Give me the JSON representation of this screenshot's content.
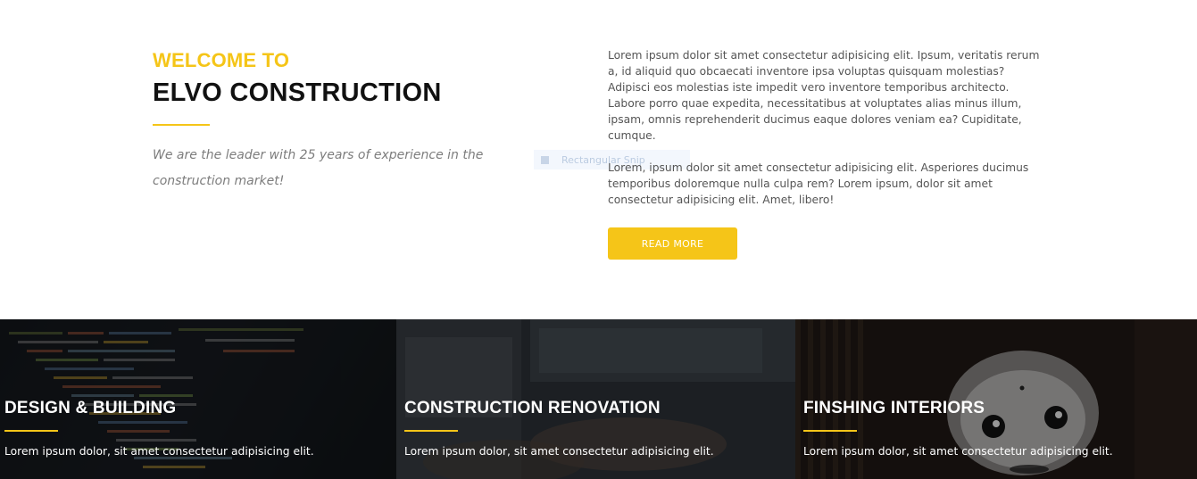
{
  "intro": {
    "welcome": "WELCOME TO",
    "title": "ELVO CONSTRUCTION",
    "tagline": "We are the leader with 25 years of experience in the construction market!",
    "paragraph_1": "Lorem ipsum dolor sit amet consectetur adipisicing elit. Ipsum, veritatis rerum a, id aliquid quo obcaecati inventore ipsa voluptas quisquam molestias? Adipisci eos molestias iste impedit vero inventore temporibus architecto. Labore porro quae expedita, necessitatibus at voluptates alias minus illum, ipsam, omnis reprehenderit ducimus eaque dolores veniam ea? Cupiditate, cumque.",
    "paragraph_2": "Lorem, ipsum dolor sit amet consectetur adipisicing elit. Asperiores ducimus temporibus doloremque nulla culpa rem? Lorem ipsum, dolor sit amet consectetur adipisicing elit. Amet, libero!",
    "read_more_label": "READ MORE",
    "ghost_label": "Rectangular Snip"
  },
  "services": [
    {
      "title": "DESIGN & BUILDING",
      "text": "Lorem ipsum dolor, sit amet consectetur adipisicing elit.",
      "image_icon": "code-screen-image"
    },
    {
      "title": "CONSTRUCTION RENOVATION",
      "text": "Lorem ipsum dolor, sit amet consectetur adipisicing elit.",
      "image_icon": "laptop-typing-image"
    },
    {
      "title": "FINSHING INTERIORS",
      "text": "Lorem ipsum dolor, sit amet consectetur adipisicing elit.",
      "image_icon": "robot-image"
    }
  ],
  "colors": {
    "accent": "#f5c518",
    "heading": "#111111",
    "body_text": "#555555",
    "muted_text": "#7d7d7d"
  }
}
